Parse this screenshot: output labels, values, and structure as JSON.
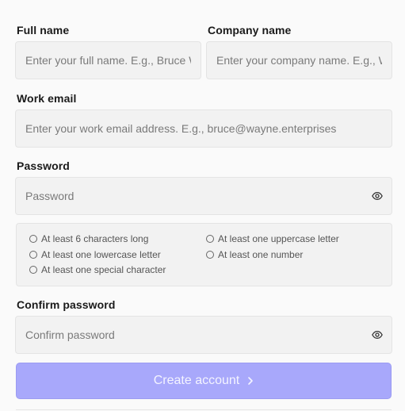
{
  "form": {
    "full_name": {
      "label": "Full name",
      "placeholder": "Enter your full name. E.g., Bruce Wayne",
      "value": ""
    },
    "company_name": {
      "label": "Company name",
      "placeholder": "Enter your company name. E.g., Wayne Enterprises",
      "value": ""
    },
    "work_email": {
      "label": "Work email",
      "placeholder": "Enter your work email address. E.g., bruce@wayne.enterprises",
      "value": ""
    },
    "password": {
      "label": "Password",
      "placeholder": "Password",
      "value": "",
      "toggle_icon": "eye-icon"
    },
    "password_rules": [
      {
        "label": "At least 6 characters long",
        "met": false
      },
      {
        "label": "At least one uppercase letter",
        "met": false
      },
      {
        "label": "At least one lowercase letter",
        "met": false
      },
      {
        "label": "At least one number",
        "met": false
      },
      {
        "label": "At least one special character",
        "met": false
      }
    ],
    "confirm_password": {
      "label": "Confirm password",
      "placeholder": "Confirm password",
      "value": "",
      "toggle_icon": "eye-icon"
    },
    "submit": {
      "label": "Create account",
      "icon": "chevron-right-icon",
      "enabled": false
    }
  },
  "colors": {
    "field_bg": "#f2f2f2",
    "button_bg": "#a8a8fb",
    "button_text": "#f4f4ff"
  }
}
